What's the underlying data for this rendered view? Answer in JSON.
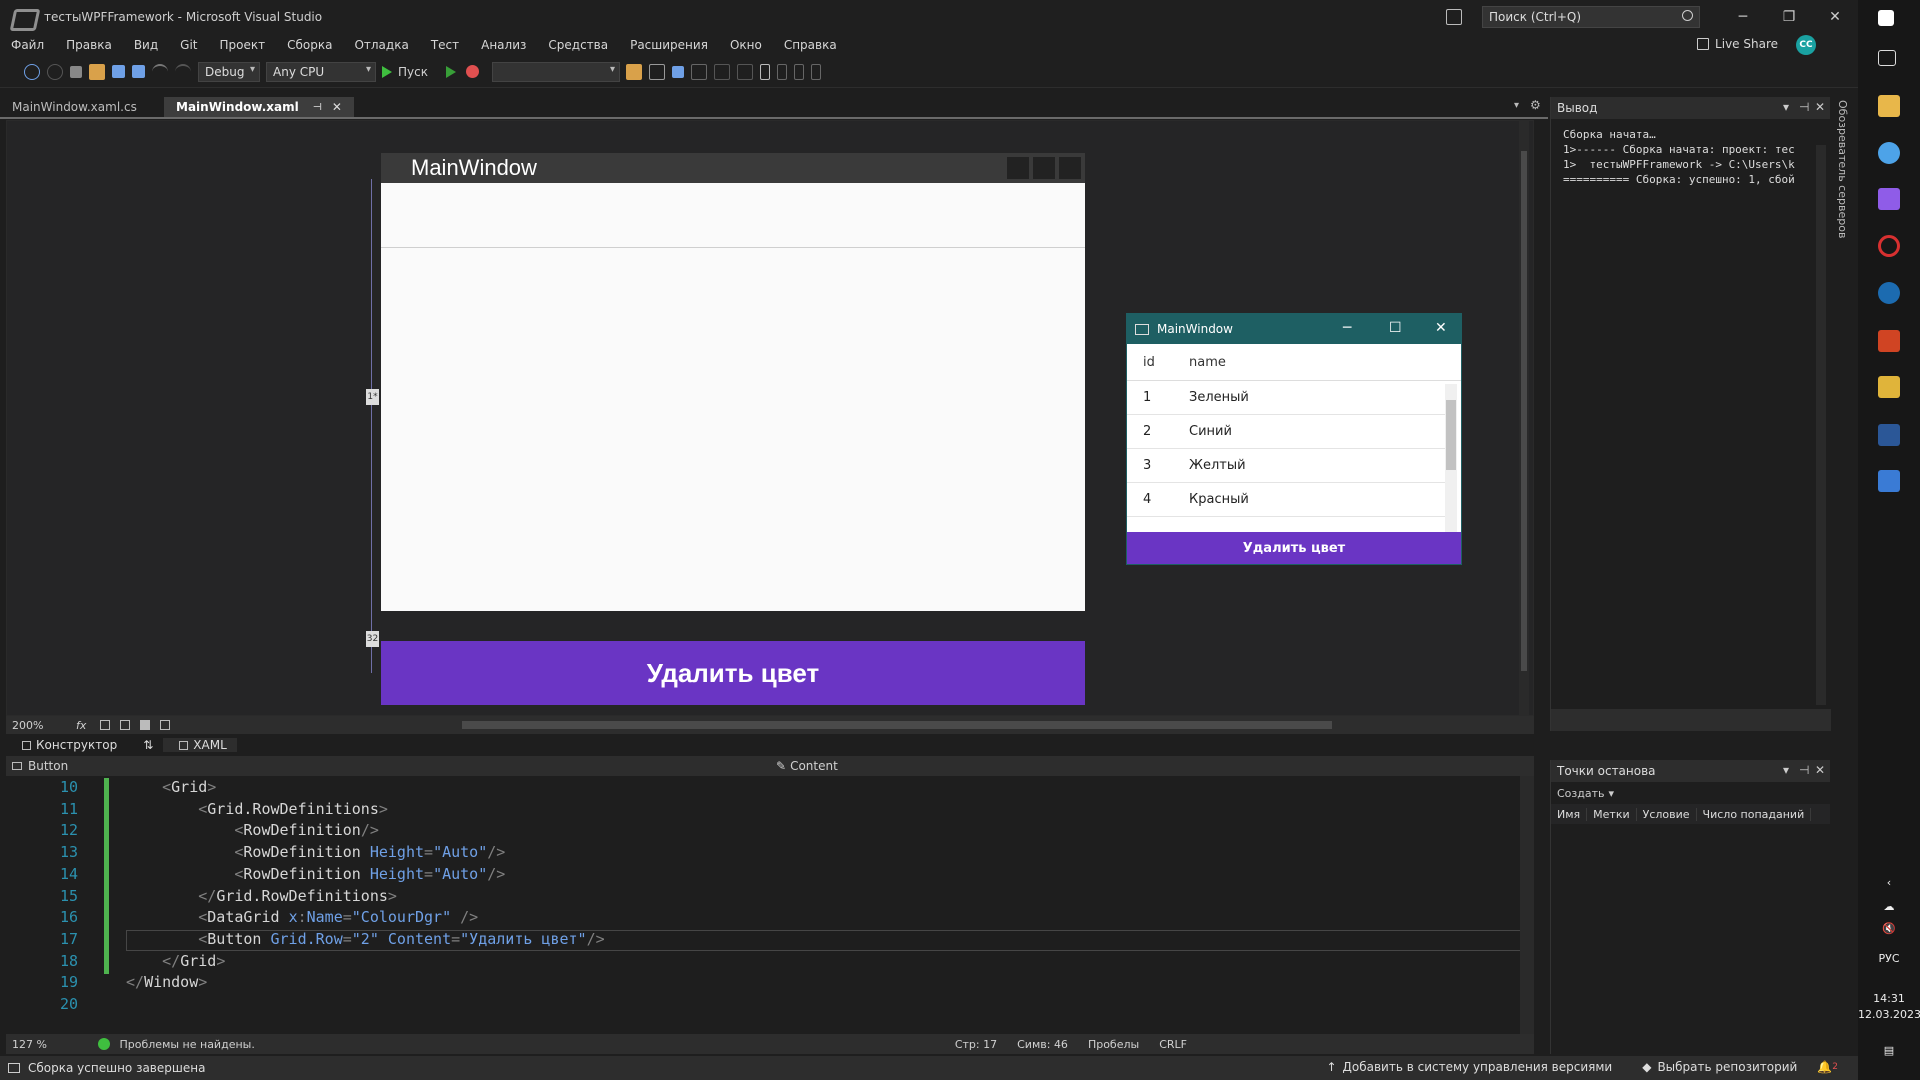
{
  "window": {
    "title": "тестыWPFFramework - Microsoft Visual Studio",
    "search_placeholder": "Поиск (Ctrl+Q)",
    "minimize": "─",
    "restore": "❐",
    "close": "✕"
  },
  "menu": [
    "Файл",
    "Правка",
    "Вид",
    "Git",
    "Проект",
    "Сборка",
    "Отладка",
    "Тест",
    "Анализ",
    "Средства",
    "Расширения",
    "Окно",
    "Справка"
  ],
  "liveshare": "Live Share",
  "avatar": "CC",
  "toolbar": {
    "config": "Debug",
    "platform": "Any CPU",
    "run": "Пуск"
  },
  "tabs": [
    {
      "label": "MainWindow.xaml.cs",
      "active": false
    },
    {
      "label": "MainWindow.xaml",
      "active": true
    }
  ],
  "designer": {
    "window_title": "MainWindow",
    "button_label": "Удалить цвет",
    "ruler_tag_1": "1*",
    "ruler_tag_2": "32",
    "zoom": "200%",
    "fx": "fx"
  },
  "app": {
    "title": "MainWindow",
    "minimize": "─",
    "maximize": "☐",
    "close": "✕",
    "columns": [
      "id",
      "name"
    ],
    "rows": [
      {
        "id": "1",
        "name": "Зеленый"
      },
      {
        "id": "2",
        "name": "Синий"
      },
      {
        "id": "3",
        "name": "Желтый"
      },
      {
        "id": "4",
        "name": "Красный"
      }
    ],
    "button_label": "Удалить цвет"
  },
  "split": {
    "designer_tab": "Конструктор",
    "swap": "⇅",
    "xaml_tab": "XAML"
  },
  "nav": {
    "element": "Button",
    "property": "Content"
  },
  "code": [
    {
      "n": "10",
      "parts": [
        [
          "t-br",
          "    <"
        ],
        [
          "t-tag",
          "Grid"
        ],
        [
          "t-br",
          ">"
        ]
      ]
    },
    {
      "n": "11",
      "parts": [
        [
          "t-br",
          "        <"
        ],
        [
          "t-tag",
          "Grid.RowDefinitions"
        ],
        [
          "t-br",
          ">"
        ]
      ]
    },
    {
      "n": "12",
      "parts": [
        [
          "t-br",
          "            <"
        ],
        [
          "t-tag",
          "RowDefinition"
        ],
        [
          "t-br",
          "/>"
        ]
      ]
    },
    {
      "n": "13",
      "parts": [
        [
          "t-br",
          "            <"
        ],
        [
          "t-tag",
          "RowDefinition "
        ],
        [
          "t-attr",
          "Height"
        ],
        [
          "t-br",
          "="
        ],
        [
          "t-attr",
          "\"Auto\""
        ],
        [
          "t-br",
          "/>"
        ]
      ]
    },
    {
      "n": "14",
      "parts": [
        [
          "t-br",
          "            <"
        ],
        [
          "t-tag",
          "RowDefinition "
        ],
        [
          "t-attr",
          "Height"
        ],
        [
          "t-br",
          "="
        ],
        [
          "t-attr",
          "\"Auto\""
        ],
        [
          "t-br",
          "/>"
        ]
      ]
    },
    {
      "n": "15",
      "parts": [
        [
          "t-br",
          "        </"
        ],
        [
          "t-tag",
          "Grid.RowDefinitions"
        ],
        [
          "t-br",
          ">"
        ]
      ]
    },
    {
      "n": "16",
      "parts": [
        [
          "t-br",
          "        <"
        ],
        [
          "t-tag",
          "DataGrid "
        ],
        [
          "t-attr",
          "x"
        ],
        [
          "t-br",
          ":"
        ],
        [
          "t-attr",
          "Name"
        ],
        [
          "t-br",
          "="
        ],
        [
          "t-attr",
          "\"ColourDgr\""
        ],
        [
          "t-br",
          " />"
        ]
      ]
    },
    {
      "n": "17",
      "parts": [
        [
          "t-br",
          "        <"
        ],
        [
          "t-tag",
          "Button "
        ],
        [
          "t-attr",
          "Grid.Row"
        ],
        [
          "t-br",
          "="
        ],
        [
          "t-attr",
          "\"2\""
        ],
        [
          "t-br",
          " "
        ],
        [
          "t-attr",
          "Content"
        ],
        [
          "t-br",
          "="
        ],
        [
          "t-attr",
          "\"Удалить цвет\""
        ],
        [
          "t-br",
          "/>"
        ]
      ]
    },
    {
      "n": "18",
      "parts": [
        [
          "t-br",
          "    </"
        ],
        [
          "t-tag",
          "Grid"
        ],
        [
          "t-br",
          ">"
        ]
      ]
    },
    {
      "n": "19",
      "parts": [
        [
          "t-br",
          "</"
        ],
        [
          "t-tag",
          "Window"
        ],
        [
          "t-br",
          ">"
        ]
      ]
    },
    {
      "n": "20",
      "parts": []
    }
  ],
  "editor_status": {
    "zoom": "127 %",
    "problems": "Проблемы не найдены.",
    "line": "Стр: 17",
    "col": "Симв: 46",
    "spaces": "Пробелы",
    "eol": "CRLF"
  },
  "output": {
    "title": "Вывод",
    "text": "Сборка начата…\n1>------ Сборка начата: проект: тес\n1>  тестыWPFFramework -> C:\\Users\\k\n========== Сборка: успешно: 1, сбой"
  },
  "server_explorer": "Обозреватель серверов",
  "breakpoints": {
    "title": "Точки останова",
    "create": "Создать",
    "columns": [
      "Имя",
      "Метки",
      "Условие",
      "Число попаданий"
    ]
  },
  "statusbar": {
    "build": "Сборка успешно завершена",
    "vcs": "Добавить в систему управления версиями",
    "repo": "Выбрать репозиторий",
    "notif": "2"
  },
  "taskbar": {
    "lang": "РУС",
    "time": "14:31",
    "date": "12.03.2023"
  },
  "colors": {
    "accent": "#6a35c4",
    "app_title": "#1e5f63",
    "change_bar": "#4fb34f"
  }
}
